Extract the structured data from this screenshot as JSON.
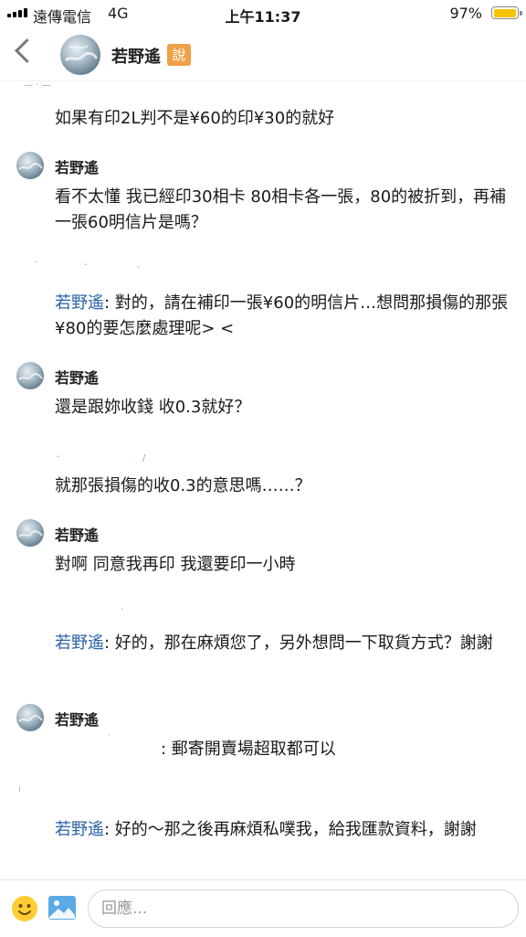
{
  "status_bar": {
    "carrier": "遠傳電信",
    "network": "4G",
    "time": "上午11:37",
    "battery": "97%",
    "battery_level": 0.97
  },
  "header": {
    "title": "若野遙",
    "badge": "說"
  },
  "messages": [
    {
      "text": "如果有印2L判不是¥60的印¥30的就好"
    },
    {
      "sender": "若野遙",
      "text": "看不太懂 我已經印30相卡 80相卡各一張，80的被折到，再補一張60明信片是嗎？"
    },
    {
      "mention": "若野遙",
      "text": ": 對的，請在補印一張¥60的明信片…想問那損傷的那張¥80的要怎麼處理呢> <"
    },
    {
      "sender": "若野遙",
      "text": "還是跟妳收錢 收0.3就好？"
    },
    {
      "text": "就那張損傷的收0.3的意思嗎……？"
    },
    {
      "sender": "若野遙",
      "text": "對啊 同意我再印 我還要印一小時"
    },
    {
      "mention": "若野遙",
      "text": ": 好的，那在麻煩您了，另外想問一下取貨方式？謝謝"
    },
    {
      "sender": "若野遙",
      "text": ": 郵寄開賣場超取都可以"
    },
    {
      "mention": "若野遙",
      "text": ": 好的～那之後再麻煩私噗我，給我匯款資料，謝謝"
    }
  ],
  "input": {
    "placeholder": "回應..."
  },
  "icons": {
    "back": "chevron-left-icon",
    "emoji": "smiley-icon",
    "image": "image-icon"
  },
  "colors": {
    "badge": "#f0a046",
    "mention": "#2b63a8",
    "battery": "#f5c400"
  }
}
